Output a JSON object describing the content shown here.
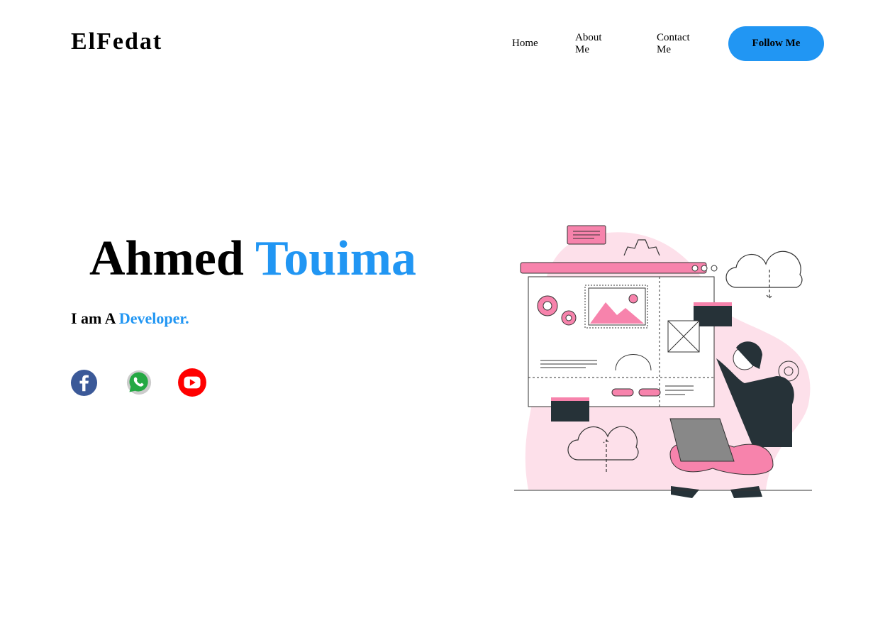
{
  "header": {
    "logo": "ElFedat",
    "nav": [
      "Home",
      "About Me",
      "Contact Me"
    ],
    "follow_label": "Follow Me"
  },
  "hero": {
    "first_name": "Ahmed",
    "last_name": "Touima",
    "tagline_prefix": "I am A",
    "tagline_role": "Developer."
  },
  "social": [
    "facebook-icon",
    "whatsapp-icon",
    "youtube-icon"
  ],
  "colors": {
    "accent": "#2196f3",
    "illustration_pink": "#f783ac"
  }
}
